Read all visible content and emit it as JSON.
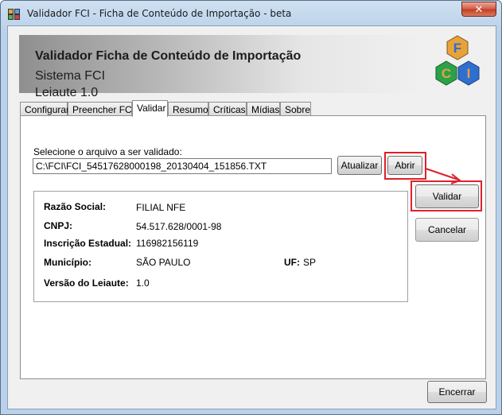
{
  "window": {
    "title": "Validador FCI - Ficha de Conteúdo de Importação - beta",
    "close_glyph": "✕"
  },
  "header": {
    "title": "Validador Ficha de Conteúdo de Importação",
    "subtitle1": "Sistema FCI",
    "subtitle2": "Leiaute 1.0"
  },
  "logo": {
    "letters": [
      "F",
      "C",
      "I"
    ],
    "colors": {
      "hex_orange": "#e8a23a",
      "hex_blue": "#2e6fd0",
      "hex_green": "#2aa24a",
      "letter": "#d68a1a"
    }
  },
  "tabs": [
    {
      "label": "Configurar"
    },
    {
      "label": "Preencher FCI"
    },
    {
      "label": "Validar"
    },
    {
      "label": "Resumo"
    },
    {
      "label": "Críticas"
    },
    {
      "label": "Mídias"
    },
    {
      "label": "Sobre"
    }
  ],
  "validar": {
    "select_label": "Selecione o arquivo a ser validado:",
    "file_path": "C:\\FCI\\FCI_54517628000198_20130404_151856.TXT",
    "atualizar_label": "Atualizar",
    "abrir_label": "Abrir",
    "validar_label": "Validar",
    "cancelar_label": "Cancelar"
  },
  "info": {
    "razao_social_label": "Razão Social:",
    "razao_social_value": "FILIAL NFE",
    "cnpj_label": "CNPJ:",
    "cnpj_value": "54.517.628/0001-98",
    "ie_label": "Inscrição Estadual:",
    "ie_value": "116982156119",
    "municipio_label": "Município:",
    "municipio_value": "SÃO PAULO",
    "uf_label": "UF:",
    "uf_value": "SP",
    "versao_label": "Versão do Leiaute:",
    "versao_value": "1.0"
  },
  "footer": {
    "encerrar_label": "Encerrar"
  },
  "colors": {
    "highlight_red": "#e0202a"
  }
}
